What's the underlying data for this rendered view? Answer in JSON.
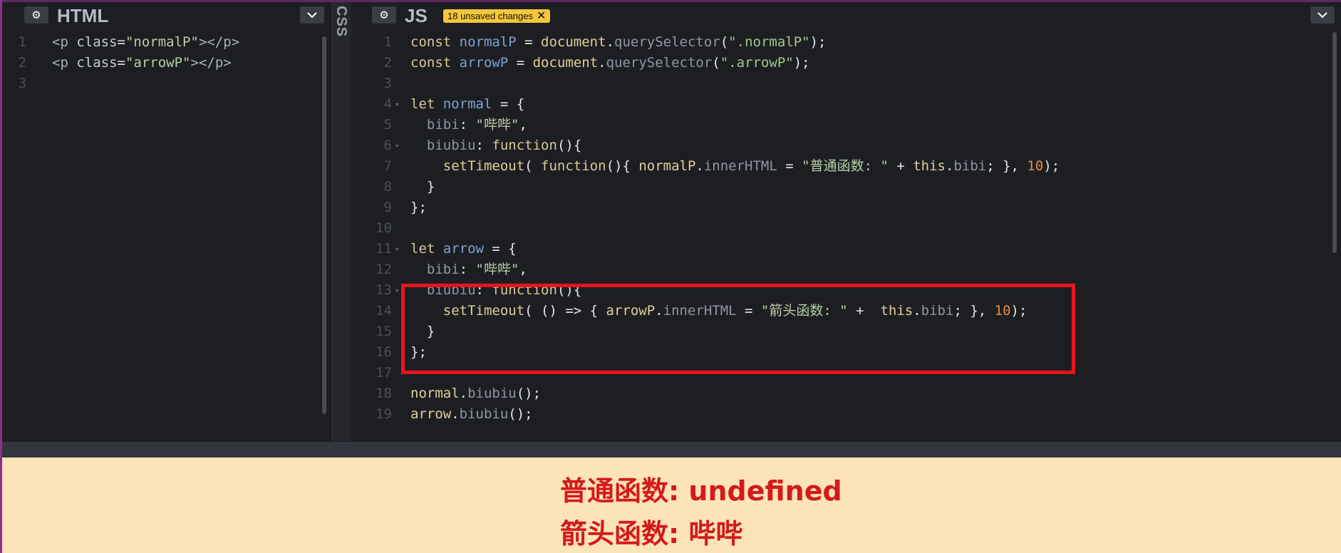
{
  "html_pane": {
    "title": "HTML",
    "lines": [
      {
        "n": "1",
        "segments": [
          [
            "t-tag",
            "<p "
          ],
          [
            "t-attr",
            "class"
          ],
          [
            "t-plain",
            "="
          ],
          [
            "t-str",
            "\"normalP\""
          ],
          [
            "t-tag",
            "></p>"
          ]
        ]
      },
      {
        "n": "2",
        "segments": [
          [
            "t-tag",
            "<p "
          ],
          [
            "t-attr",
            "class"
          ],
          [
            "t-plain",
            "="
          ],
          [
            "t-str",
            "\"arrowP\""
          ],
          [
            "t-tag",
            "></p>"
          ]
        ]
      },
      {
        "n": "3",
        "segments": []
      }
    ]
  },
  "css_pane": {
    "title": "CSS"
  },
  "js_pane": {
    "title": "JS",
    "badge": "18 unsaved changes",
    "lines": [
      {
        "n": "1",
        "segments": [
          [
            "t-kw",
            "const "
          ],
          [
            "t-var",
            "normalP"
          ],
          [
            "t-plain",
            " = "
          ],
          [
            "t-fn",
            "document"
          ],
          [
            "t-plain",
            "."
          ],
          [
            "t-prop",
            "querySelector"
          ],
          [
            "t-plain",
            "("
          ],
          [
            "t-str2",
            "\".normalP\""
          ],
          [
            "t-plain",
            ");"
          ]
        ]
      },
      {
        "n": "2",
        "segments": [
          [
            "t-kw",
            "const "
          ],
          [
            "t-var",
            "arrowP"
          ],
          [
            "t-plain",
            " = "
          ],
          [
            "t-fn",
            "document"
          ],
          [
            "t-plain",
            "."
          ],
          [
            "t-prop",
            "querySelector"
          ],
          [
            "t-plain",
            "("
          ],
          [
            "t-str2",
            "\".arrowP\""
          ],
          [
            "t-plain",
            ");"
          ]
        ]
      },
      {
        "n": "3",
        "segments": []
      },
      {
        "n": "4",
        "fold": true,
        "segments": [
          [
            "t-kw",
            "let "
          ],
          [
            "t-var",
            "normal"
          ],
          [
            "t-plain",
            " = {"
          ]
        ]
      },
      {
        "n": "5",
        "segments": [
          [
            "t-plain",
            "  "
          ],
          [
            "t-prop",
            "bibi"
          ],
          [
            "t-plain",
            ": "
          ],
          [
            "t-cn",
            "\"哔哔\""
          ],
          [
            "t-plain",
            ","
          ]
        ]
      },
      {
        "n": "6",
        "fold": true,
        "segments": [
          [
            "t-plain",
            "  "
          ],
          [
            "t-prop",
            "biubiu"
          ],
          [
            "t-plain",
            ": "
          ],
          [
            "t-kw",
            "function"
          ],
          [
            "t-plain",
            "(){"
          ]
        ]
      },
      {
        "n": "7",
        "segments": [
          [
            "t-plain",
            "    "
          ],
          [
            "t-fn",
            "setTimeout"
          ],
          [
            "t-plain",
            "( "
          ],
          [
            "t-kw",
            "function"
          ],
          [
            "t-plain",
            "(){ "
          ],
          [
            "t-fn",
            "normalP"
          ],
          [
            "t-plain",
            "."
          ],
          [
            "t-prop",
            "innerHTML"
          ],
          [
            "t-plain",
            " = "
          ],
          [
            "t-cn",
            "\"普通函数: \""
          ],
          [
            "t-plain",
            " + "
          ],
          [
            "t-fn",
            "this"
          ],
          [
            "t-plain",
            "."
          ],
          [
            "t-prop",
            "bibi"
          ],
          [
            "t-plain",
            "; }, "
          ],
          [
            "t-num",
            "10"
          ],
          [
            "t-plain",
            ");"
          ]
        ]
      },
      {
        "n": "8",
        "segments": [
          [
            "t-plain",
            "  }"
          ]
        ]
      },
      {
        "n": "9",
        "segments": [
          [
            "t-plain",
            "};"
          ]
        ]
      },
      {
        "n": "10",
        "segments": []
      },
      {
        "n": "11",
        "fold": true,
        "segments": [
          [
            "t-kw",
            "let "
          ],
          [
            "t-var",
            "arrow"
          ],
          [
            "t-plain",
            " = {"
          ]
        ]
      },
      {
        "n": "12",
        "segments": [
          [
            "t-plain",
            "  "
          ],
          [
            "t-prop",
            "bibi"
          ],
          [
            "t-plain",
            ": "
          ],
          [
            "t-cn",
            "\"哔哔\""
          ],
          [
            "t-plain",
            ","
          ]
        ]
      },
      {
        "n": "13",
        "fold": true,
        "segments": [
          [
            "t-plain",
            "  "
          ],
          [
            "t-prop",
            "biubiu"
          ],
          [
            "t-plain",
            ": "
          ],
          [
            "t-kw",
            "function"
          ],
          [
            "t-plain",
            "(){"
          ]
        ]
      },
      {
        "n": "14",
        "segments": [
          [
            "t-plain",
            "    "
          ],
          [
            "t-fn",
            "setTimeout"
          ],
          [
            "t-plain",
            "( () => { "
          ],
          [
            "t-fn",
            "arrowP"
          ],
          [
            "t-plain",
            "."
          ],
          [
            "t-prop",
            "innerHTML"
          ],
          [
            "t-plain",
            " = "
          ],
          [
            "t-cn",
            "\"箭头函数: \""
          ],
          [
            "t-plain",
            " +  "
          ],
          [
            "t-fn",
            "this"
          ],
          [
            "t-plain",
            "."
          ],
          [
            "t-prop",
            "bibi"
          ],
          [
            "t-plain",
            "; }, "
          ],
          [
            "t-num",
            "10"
          ],
          [
            "t-plain",
            ");"
          ]
        ]
      },
      {
        "n": "15",
        "segments": [
          [
            "t-plain",
            "  }"
          ]
        ]
      },
      {
        "n": "16",
        "segments": [
          [
            "t-plain",
            "};"
          ]
        ]
      },
      {
        "n": "17",
        "segments": []
      },
      {
        "n": "18",
        "segments": [
          [
            "t-fn",
            "normal"
          ],
          [
            "t-plain",
            "."
          ],
          [
            "t-prop",
            "biubiu"
          ],
          [
            "t-plain",
            "();"
          ]
        ]
      },
      {
        "n": "19",
        "segments": [
          [
            "t-fn",
            "arrow"
          ],
          [
            "t-plain",
            "."
          ],
          [
            "t-prop",
            "biubiu"
          ],
          [
            "t-plain",
            "();"
          ]
        ]
      }
    ]
  },
  "output": {
    "line1": "普通函数: undefined",
    "line2": "箭头函数: 哔哔"
  },
  "colors": {
    "highlight_box": "#e8141c",
    "output_bg": "#fde3b8",
    "output_text": "#d41a1a",
    "badge_bg": "#f4c73a"
  },
  "icons": {
    "settings": "gear-icon",
    "collapse": "chevron-down-icon",
    "dismiss": "close-icon"
  }
}
